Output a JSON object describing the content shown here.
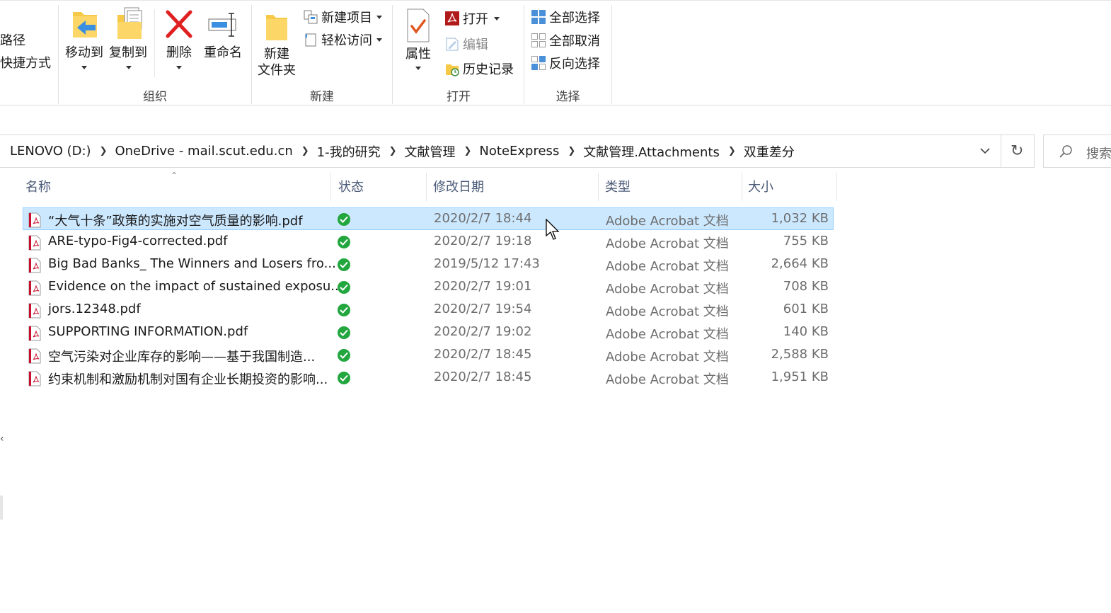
{
  "ribbon": {
    "clipboard_partial": {
      "path_label": "路径",
      "shortcut_label": "快捷方式"
    },
    "organize": {
      "label": "组织",
      "move_to": "移动到",
      "copy_to": "复制到",
      "delete": "删除",
      "rename": "重命名"
    },
    "new": {
      "label": "新建",
      "new_folder_line1": "新建",
      "new_folder_line2": "文件夹",
      "new_item": "新建项目",
      "easy_access": "轻松访问"
    },
    "open": {
      "label": "打开",
      "properties": "属性",
      "open": "打开",
      "edit": "编辑",
      "history": "历史记录"
    },
    "select": {
      "label": "选择",
      "select_all": "全部选择",
      "select_none": "全部取消",
      "invert_selection": "反向选择"
    }
  },
  "address": {
    "crumbs": [
      "LENOVO (D:)",
      "OneDrive - mail.scut.edu.cn",
      "1-我的研究",
      "文献管理",
      "NoteExpress",
      "文献管理.Attachments",
      "双重差分"
    ],
    "search_placeholder": "搜索"
  },
  "columns": {
    "name": "名称",
    "status": "状态",
    "date": "修改日期",
    "type": "类型",
    "size": "大小"
  },
  "files": [
    {
      "name": "“大气十条”政策的实施对空气质量的影响.pdf",
      "date": "2020/2/7 18:44",
      "type": "Adobe Acrobat 文档",
      "size": "1,032 KB",
      "selected": true
    },
    {
      "name": "ARE-typo-Fig4-corrected.pdf",
      "date": "2020/2/7 19:18",
      "type": "Adobe Acrobat 文档",
      "size": "755 KB"
    },
    {
      "name": "Big Bad Banks_ The Winners and Losers fro...",
      "date": "2019/5/12 17:43",
      "type": "Adobe Acrobat 文档",
      "size": "2,664 KB"
    },
    {
      "name": "Evidence on the impact of sustained exposu...",
      "date": "2020/2/7 19:01",
      "type": "Adobe Acrobat 文档",
      "size": "708 KB"
    },
    {
      "name": "jors.12348.pdf",
      "date": "2020/2/7 19:54",
      "type": "Adobe Acrobat 文档",
      "size": "601 KB"
    },
    {
      "name": "SUPPORTING INFORMATION.pdf",
      "date": "2020/2/7 19:02",
      "type": "Adobe Acrobat 文档",
      "size": "140 KB"
    },
    {
      "name": "空气污染对企业库存的影响——基于我国制造...",
      "date": "2020/2/7 18:45",
      "type": "Adobe Acrobat 文档",
      "size": "2,588 KB"
    },
    {
      "name": "约束机制和激励机制对国有企业长期投资的影响...",
      "date": "2020/2/7 18:45",
      "type": "Adobe Acrobat 文档",
      "size": "1,951 KB"
    }
  ],
  "colors": {
    "selection_bg": "#cce8ff",
    "selection_border": "#99d1ff",
    "status_green": "#22a63e",
    "pdf_red": "#c8102e",
    "folder_yellow": "#f7c948"
  }
}
